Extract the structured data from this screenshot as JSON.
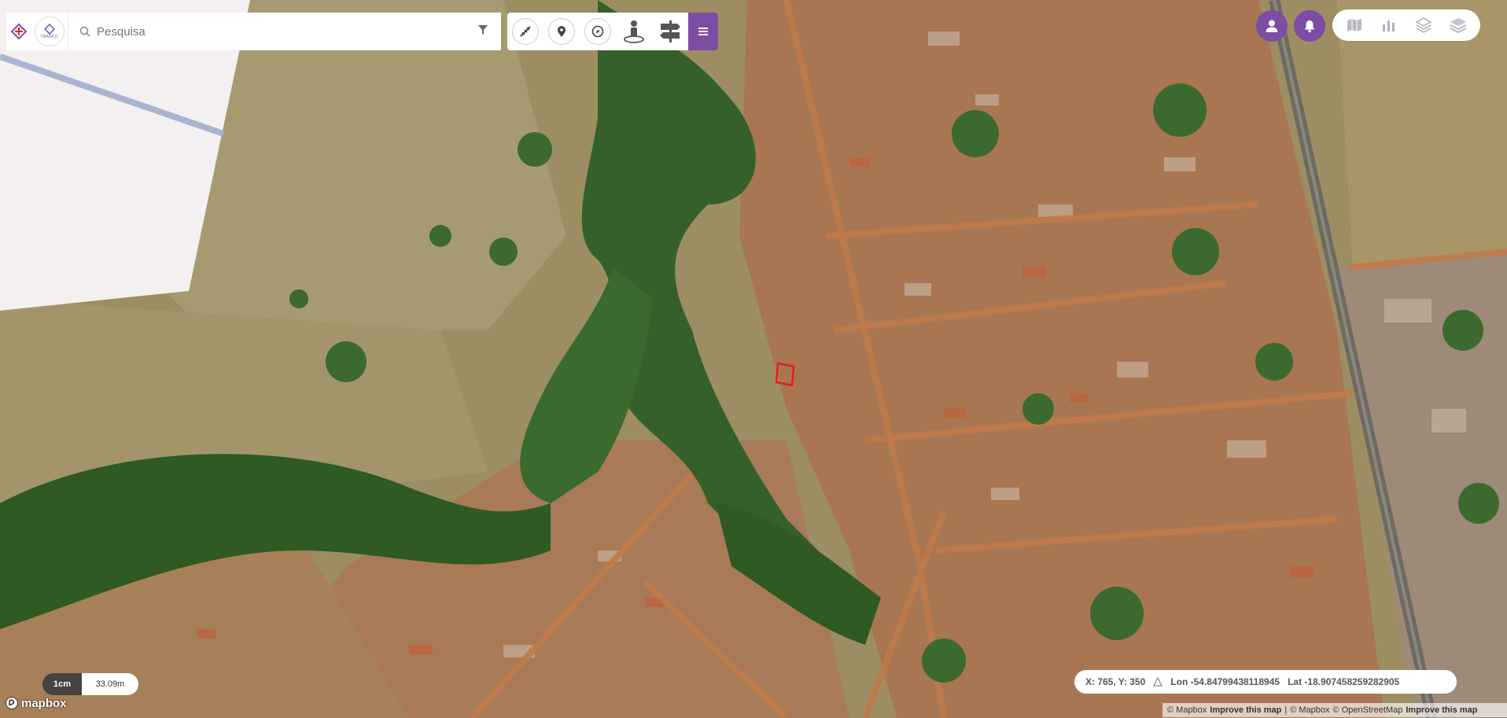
{
  "search": {
    "placeholder": "Pesquisa"
  },
  "logo": {
    "sub_text": "TRANCO"
  },
  "toolbar": {
    "tools": [
      {
        "name": "measure-tool",
        "icon": "measure-icon"
      },
      {
        "name": "marker-tool",
        "icon": "map-pin-icon"
      },
      {
        "name": "compass-tool",
        "icon": "compass-icon"
      },
      {
        "name": "street-view-tool",
        "icon": "person-icon"
      },
      {
        "name": "signpost-tool",
        "icon": "signpost-icon"
      }
    ],
    "menu_icon": "hamburger-icon"
  },
  "top_right": {
    "user_icon": "user-icon",
    "bell_icon": "bell-icon",
    "layers": [
      "map-icon",
      "bar-chart-icon",
      "layers-outline-icon",
      "layers-filled-icon"
    ]
  },
  "scale": {
    "unit": "1cm",
    "value": "33.09m"
  },
  "coordinates": {
    "xy": "X: 765, Y: 350",
    "lon": "Lon -54.84799438118945",
    "lat": "Lat -18.907458259282905"
  },
  "attribution": {
    "mapbox1": "© Mapbox",
    "improve1": "Improve this map",
    "mapbox2": "© Mapbox",
    "osm": "© OpenStreetMap",
    "improve2": "Improve this map"
  },
  "brand": {
    "mapbox_logo_text": "mapbox"
  },
  "colors": {
    "accent": "#7d4ca3",
    "marker": "#e0201e"
  }
}
